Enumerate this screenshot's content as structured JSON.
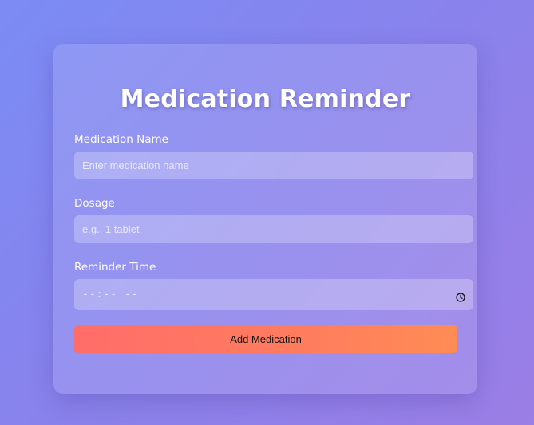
{
  "form": {
    "title": "Medication Reminder",
    "name_label": "Medication Name",
    "name_placeholder": "Enter medication name",
    "dosage_label": "Dosage",
    "dosage_placeholder": "e.g., 1 tablet",
    "time_label": "Reminder Time",
    "time_placeholder": "--:-- --",
    "time_icon": "clock-icon",
    "submit_label": "Add Medication"
  },
  "colors": {
    "background_start": "#7b8cf5",
    "background_end": "#9b7ee6",
    "button_start": "#ff6d6a",
    "button_end": "#ff8c55",
    "text": "#ffffff"
  }
}
